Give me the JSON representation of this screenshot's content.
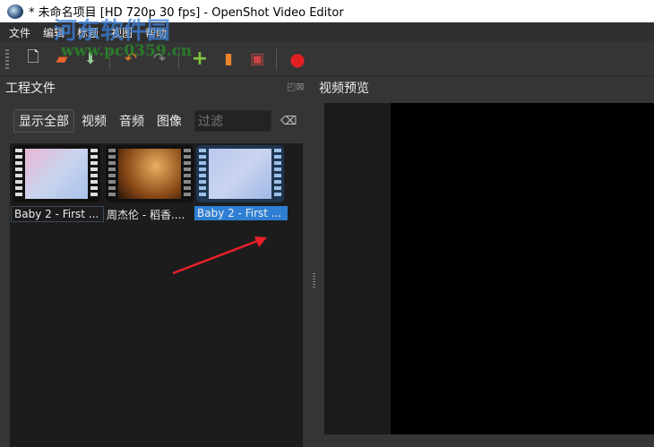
{
  "window": {
    "title": "* 未命名项目 [HD 720p 30 fps] - OpenShot Video Editor"
  },
  "watermark": {
    "text": "河东软件园",
    "url": "www.pc0359.cn"
  },
  "menu": [
    "文件",
    "编辑",
    "标题",
    "视图",
    "帮助"
  ],
  "toolbar": [
    "new-project",
    "open-project",
    "save-project",
    "undo",
    "redo",
    "import-files",
    "choose-profile",
    "fullscreen",
    "export-video"
  ],
  "project_files": {
    "title": "工程文件",
    "filters": {
      "all": "显示全部",
      "video": "视频",
      "audio": "音频",
      "image": "图像"
    },
    "filter_placeholder": "过滤",
    "items": [
      {
        "label": "Baby 2 - First ..."
      },
      {
        "label": "周杰伦 - 稻香...."
      },
      {
        "label": "Baby 2 - First ..."
      }
    ]
  },
  "preview": {
    "title": "视频预览"
  },
  "colors": {
    "selection": "#2e7fd3",
    "annotation_arrow": "#e8202a"
  }
}
